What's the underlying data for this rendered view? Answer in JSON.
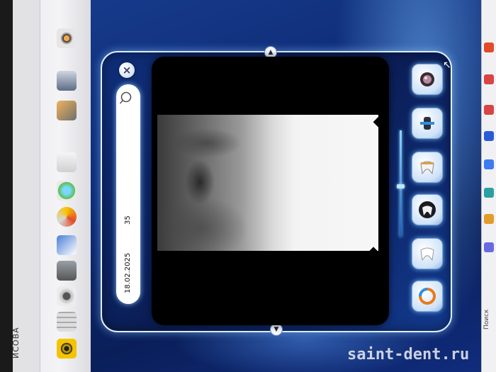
{
  "left_panel": {
    "patient_name_fragment": "ИСОВА"
  },
  "viewer": {
    "info": {
      "date": "18.02.2025",
      "tooth_number": "35"
    },
    "close_label": "×",
    "top_handle": "▲",
    "bottom_handle": "▼",
    "tools": [
      {
        "name": "lens-tool"
      },
      {
        "name": "tooth-measure-tool"
      },
      {
        "name": "tooth-view-1"
      },
      {
        "name": "tooth-view-2"
      },
      {
        "name": "tooth-view-3"
      },
      {
        "name": "rotate-tool"
      }
    ]
  },
  "right_strip": {
    "search_label": "Поиск"
  },
  "watermark": "saint-dent.ru",
  "colors": {
    "accent_glow": "#7fd0ff",
    "window_bg": "#0b1e57",
    "frame_border": "#dfeeff"
  }
}
